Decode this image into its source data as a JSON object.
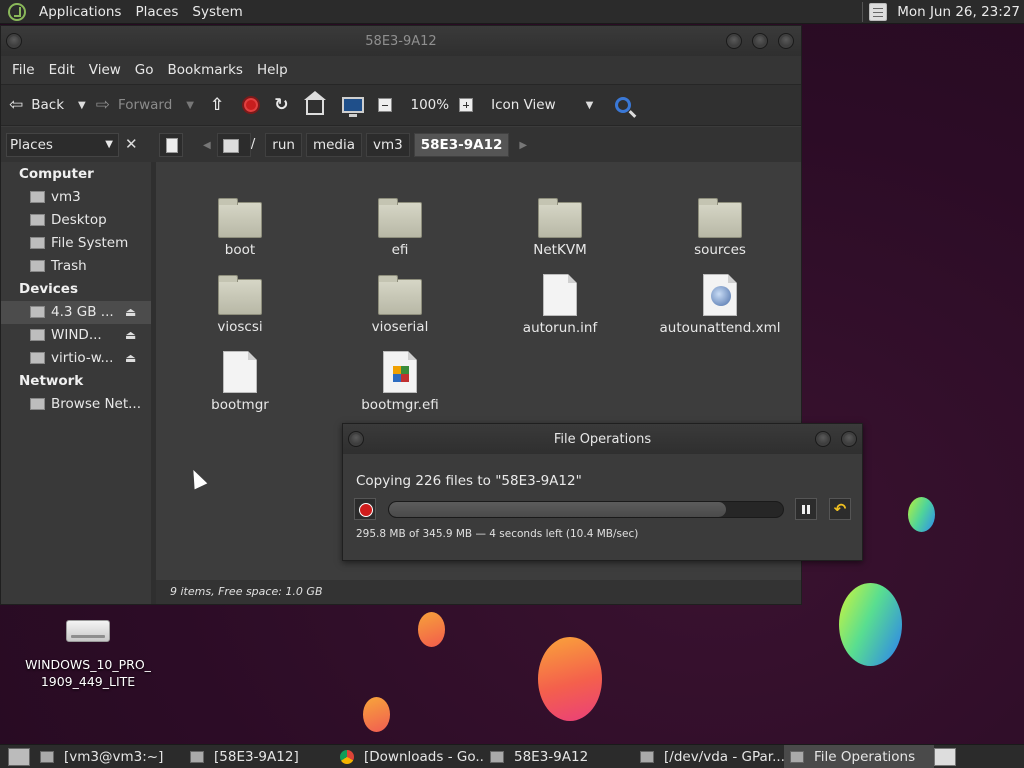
{
  "top_panel": {
    "menus": [
      "Applications",
      "Places",
      "System"
    ],
    "clock": "Mon Jun 26, 23:27"
  },
  "desktop": {
    "icon_label": "WINDOWS_10_PRO_\n1909_449_LITE"
  },
  "file_manager": {
    "title": "58E3-9A12",
    "menubar": [
      "File",
      "Edit",
      "View",
      "Go",
      "Bookmarks",
      "Help"
    ],
    "toolbar": {
      "back": "Back",
      "forward": "Forward",
      "zoom": "100%",
      "view_mode": "Icon View"
    },
    "sidebar_selector": "Places",
    "breadcrumb": [
      "/",
      "run",
      "media",
      "vm3",
      "58E3-9A12"
    ],
    "sidebar": {
      "computer_header": "Computer",
      "computer_items": [
        "vm3",
        "Desktop",
        "File System",
        "Trash"
      ],
      "devices_header": "Devices",
      "devices_items": [
        "4.3 GB ...",
        "WIND...",
        "virtio-w..."
      ],
      "network_header": "Network",
      "network_items": [
        "Browse Net..."
      ]
    },
    "files": [
      {
        "name": "boot",
        "type": "folder"
      },
      {
        "name": "efi",
        "type": "folder"
      },
      {
        "name": "NetKVM",
        "type": "folder"
      },
      {
        "name": "sources",
        "type": "folder"
      },
      {
        "name": "vioscsi",
        "type": "folder"
      },
      {
        "name": "vioserial",
        "type": "folder"
      },
      {
        "name": "autorun.inf",
        "type": "text-file"
      },
      {
        "name": "autounattend.xml",
        "type": "xml-file"
      },
      {
        "name": "bootmgr",
        "type": "file"
      },
      {
        "name": "bootmgr.efi",
        "type": "efi-file"
      }
    ],
    "status": "9 items, Free space: 1.0 GB"
  },
  "file_operations": {
    "title": "File Operations",
    "message": "Copying 226 files to \"58E3-9A12\"",
    "progress_fraction": 0.855,
    "details": "295.8 MB of 345.9 MB — 4 seconds left (10.4 MB/sec)"
  },
  "taskbar": {
    "items": [
      "[vm3@vm3:~]",
      "[58E3-9A12]",
      "[Downloads - Go...",
      "58E3-9A12",
      "[/dev/vda - GPar...",
      "File Operations"
    ]
  },
  "colors": {
    "stop_red": "#c81e1e",
    "search_blue": "#3a78d6",
    "undo_yellow": "#f0c020"
  }
}
